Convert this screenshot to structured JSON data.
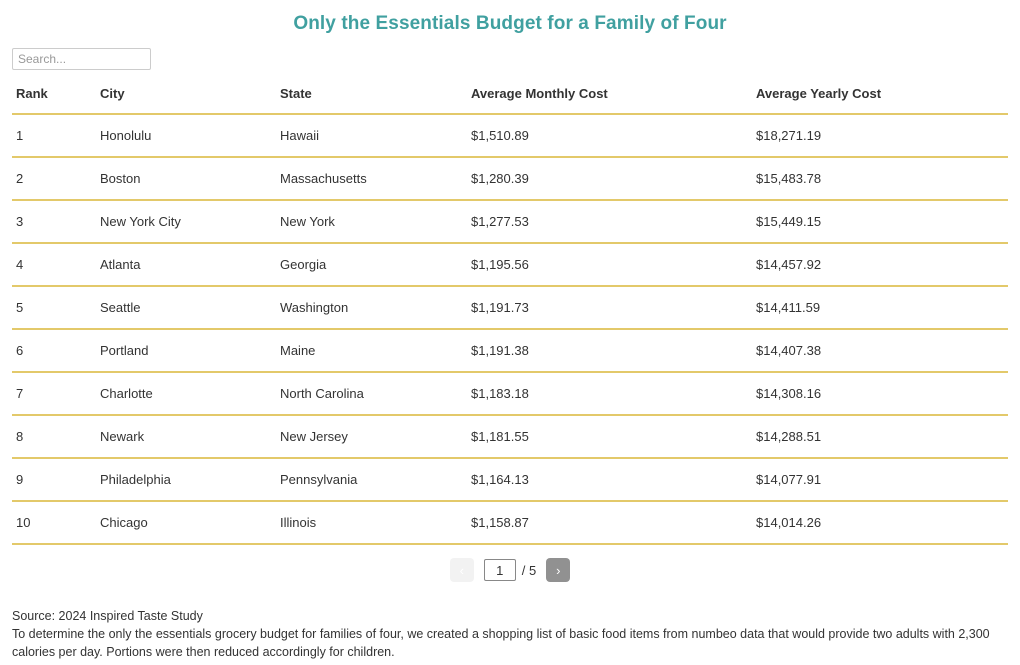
{
  "header": {
    "title": "Only the Essentials Budget for a Family of Four",
    "title_color": "#40a0a0"
  },
  "search": {
    "placeholder": "Search...",
    "value": ""
  },
  "table": {
    "border_color": "#e3c96a",
    "columns": [
      "Rank",
      "City",
      "State",
      "Average Monthly Cost",
      "Average Yearly Cost"
    ],
    "rows": [
      {
        "rank": "1",
        "city": "Honolulu",
        "state": "Hawaii",
        "monthly": "$1,510.89",
        "yearly": "$18,271.19"
      },
      {
        "rank": "2",
        "city": "Boston",
        "state": "Massachusetts",
        "monthly": "$1,280.39",
        "yearly": "$15,483.78"
      },
      {
        "rank": "3",
        "city": "New York City",
        "state": "New York",
        "monthly": "$1,277.53",
        "yearly": "$15,449.15"
      },
      {
        "rank": "4",
        "city": "Atlanta",
        "state": "Georgia",
        "monthly": "$1,195.56",
        "yearly": "$14,457.92"
      },
      {
        "rank": "5",
        "city": "Seattle",
        "state": "Washington",
        "monthly": "$1,191.73",
        "yearly": "$14,411.59"
      },
      {
        "rank": "6",
        "city": "Portland",
        "state": "Maine",
        "monthly": "$1,191.38",
        "yearly": "$14,407.38"
      },
      {
        "rank": "7",
        "city": "Charlotte",
        "state": "North Carolina",
        "monthly": "$1,183.18",
        "yearly": "$14,308.16"
      },
      {
        "rank": "8",
        "city": "Newark",
        "state": "New Jersey",
        "monthly": "$1,181.55",
        "yearly": "$14,288.51"
      },
      {
        "rank": "9",
        "city": "Philadelphia",
        "state": "Pennsylvania",
        "monthly": "$1,164.13",
        "yearly": "$14,077.91"
      },
      {
        "rank": "10",
        "city": "Chicago",
        "state": "Illinois",
        "monthly": "$1,158.87",
        "yearly": "$14,014.26"
      }
    ]
  },
  "pagination": {
    "prev_label": "‹",
    "next_label": "›",
    "current_page": "1",
    "total_label": "/ 5",
    "total_pages": "5",
    "prev_disabled": true
  },
  "footer": {
    "source": "Source: 2024 Inspired Taste Study",
    "note": "To determine the only the essentials grocery budget for families of four, we created a shopping list of basic food items from numbeo data that would provide two adults with 2,300 calories per day. Portions were then reduced accordingly for children."
  }
}
